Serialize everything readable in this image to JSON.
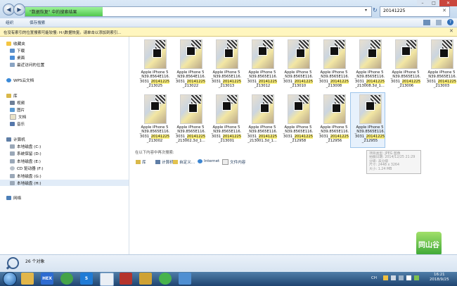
{
  "address": {
    "path_text": "\"数据恢复\" 中的搜索结果",
    "search_value": "20141225"
  },
  "toolbar": {
    "organize": "组织",
    "save_search": "保存搜索"
  },
  "infobar": {
    "text": "在没有索引的位置搜索可能较慢: H:\\数据恢复。请单击以添加到索引..."
  },
  "nav": {
    "favorites": "收藏夹",
    "downloads": "下载",
    "desktop": "桌面",
    "recent": "最近访问的位置",
    "wps": "WPS云文档",
    "libraries": "库",
    "videos": "视频",
    "pictures": "图片",
    "documents": "文档",
    "music": "音乐",
    "computer": "计算机",
    "drive_c": "本地磁盘 (C:)",
    "drive_d": "系统保留 (D:)",
    "drive_e": "本地磁盘 (E:)",
    "drive_f": "CD 驱动器 (F:)",
    "drive_g": "本地磁盘 (G:)",
    "drive_h": "本地磁盘 (H:)",
    "network": "网络"
  },
  "files": [
    {
      "l1": "Apple iPhone 5",
      "l2": "_N39.8564E116.",
      "l3": "3031_",
      "hl": "20141225",
      "l4": "_213025"
    },
    {
      "l1": "Apple iPhone 5",
      "l2": "_N39.8564E116.",
      "l3": "3031_",
      "hl": "20141225",
      "l4": "_213022"
    },
    {
      "l1": "Apple iPhone 5",
      "l2": "_N39.8565E116.",
      "l3": "3031_",
      "hl": "20141225",
      "l4": "_213013"
    },
    {
      "l1": "Apple iPhone 5",
      "l2": "_N39.8565E116.",
      "l3": "3031_",
      "hl": "20141225",
      "l4": "_213012"
    },
    {
      "l1": "Apple iPhone 5",
      "l2": "_N39.8565E116.",
      "l3": "3031_",
      "hl": "20141225",
      "l4": "_213010"
    },
    {
      "l1": "Apple iPhone 5",
      "l2": "_N39.8565E116.",
      "l3": "3031_",
      "hl": "20141225",
      "l4": "_213008"
    },
    {
      "l1": "Apple iPhone 5",
      "l2": "_N39.8565E116.",
      "l3": "3031_",
      "hl": "20141225",
      "l4": "_213008.3d_1..."
    },
    {
      "l1": "Apple iPhone 5",
      "l2": "_N39.8565E116.",
      "l3": "3031_",
      "hl": "20141225",
      "l4": "_213006"
    },
    {
      "l1": "Apple iPhone 5",
      "l2": "_N39.8565E116.",
      "l3": "3031_",
      "hl": "20141225",
      "l4": "_213003"
    },
    {
      "l1": "Apple iPhone 5",
      "l2": "_N39.8565E116.",
      "l3": "3031_",
      "hl": "20141225",
      "l4": "_213002"
    },
    {
      "l1": "Apple iPhone 5",
      "l2": "_N39.8565E116.",
      "l3": "3031_",
      "hl": "20141225",
      "l4": "_213002.3d_1..."
    },
    {
      "l1": "Apple iPhone 5",
      "l2": "_N39.8565E116.",
      "l3": "3031_",
      "hl": "20141225",
      "l4": "_213001"
    },
    {
      "l1": "Apple iPhone 5",
      "l2": "_N39.8565E116.",
      "l3": "3031_",
      "hl": "20141225",
      "l4": "_213001.3d_1..."
    },
    {
      "l1": "Apple iPhone 5",
      "l2": "_N39.8565E116.",
      "l3": "3031_",
      "hl": "20141225",
      "l4": "_212958"
    },
    {
      "l1": "Apple iPhone 5",
      "l2": "_N39.8565E116.",
      "l3": "3031_",
      "hl": "20141225",
      "l4": "_212956"
    },
    {
      "l1": "Apple iPhone 5",
      "l2": "_N39.8565E116.",
      "l3": "3031_",
      "hl": "20141225",
      "l4": "_212955"
    }
  ],
  "search_again": {
    "label": "在以下内容中再次搜索:",
    "library": "库",
    "computer": "计算机",
    "custom": "自定义...",
    "internet": "Internet",
    "file_contents": "文件内容"
  },
  "tooltip": {
    "line1": "项目类型: JPEG 图像",
    "line2": "拍摄日期: 2014/12/25 21:29",
    "line3": "分级: 未分级",
    "line4": "尺寸: 2448 x 3264",
    "line5": "大小: 1.24 MB"
  },
  "logo_text": "同山谷",
  "status": {
    "count": "26 个对象"
  },
  "taskbar": {
    "app_hex": "HEX",
    "app_5": "5"
  },
  "tray": {
    "lang": "CH",
    "time": "16:21",
    "date": "2018/9/25"
  }
}
